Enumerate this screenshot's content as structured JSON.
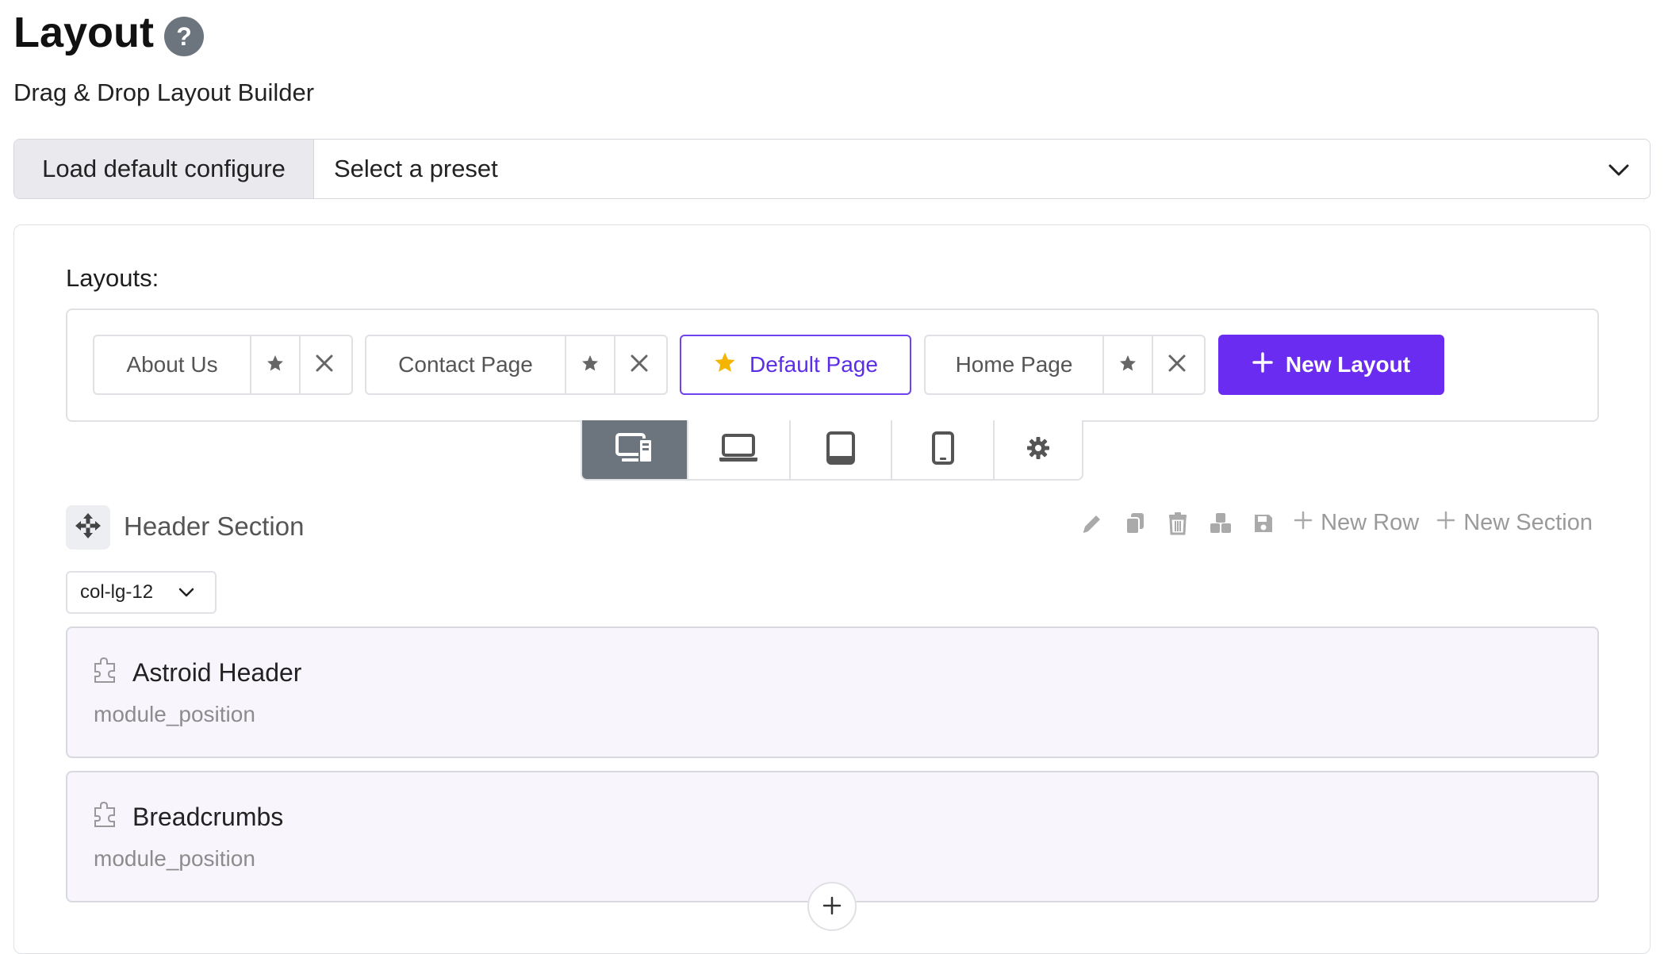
{
  "header": {
    "title": "Layout",
    "help_icon": "question-circle-icon",
    "subtitle": "Drag & Drop Layout Builder"
  },
  "preset": {
    "button_label": "Load default configure",
    "select_value": "Select a preset"
  },
  "layouts": {
    "label": "Layouts:",
    "items": [
      {
        "name": "About Us",
        "default": false
      },
      {
        "name": "Contact Page",
        "default": false
      },
      {
        "name": "Default Page",
        "default": true
      },
      {
        "name": "Home Page",
        "default": false
      }
    ],
    "new_button_label": "New Layout"
  },
  "devices": {
    "active": "desktop",
    "items": [
      "desktop-icon",
      "laptop-icon",
      "tablet-icon",
      "mobile-icon",
      "gear-icon"
    ]
  },
  "section": {
    "title": "Header Section",
    "new_row_label": "New Row",
    "new_section_label": "New Section",
    "column_select": "col-lg-12",
    "modules": [
      {
        "title": "Astroid Header",
        "subtitle": "module_position"
      },
      {
        "title": "Breadcrumbs",
        "subtitle": "module_position"
      }
    ]
  },
  "colors": {
    "accent": "#6a2cf0",
    "active_device": "#6c757d",
    "module_bg": "#f8f5fd",
    "star_default": "#f5b400"
  }
}
